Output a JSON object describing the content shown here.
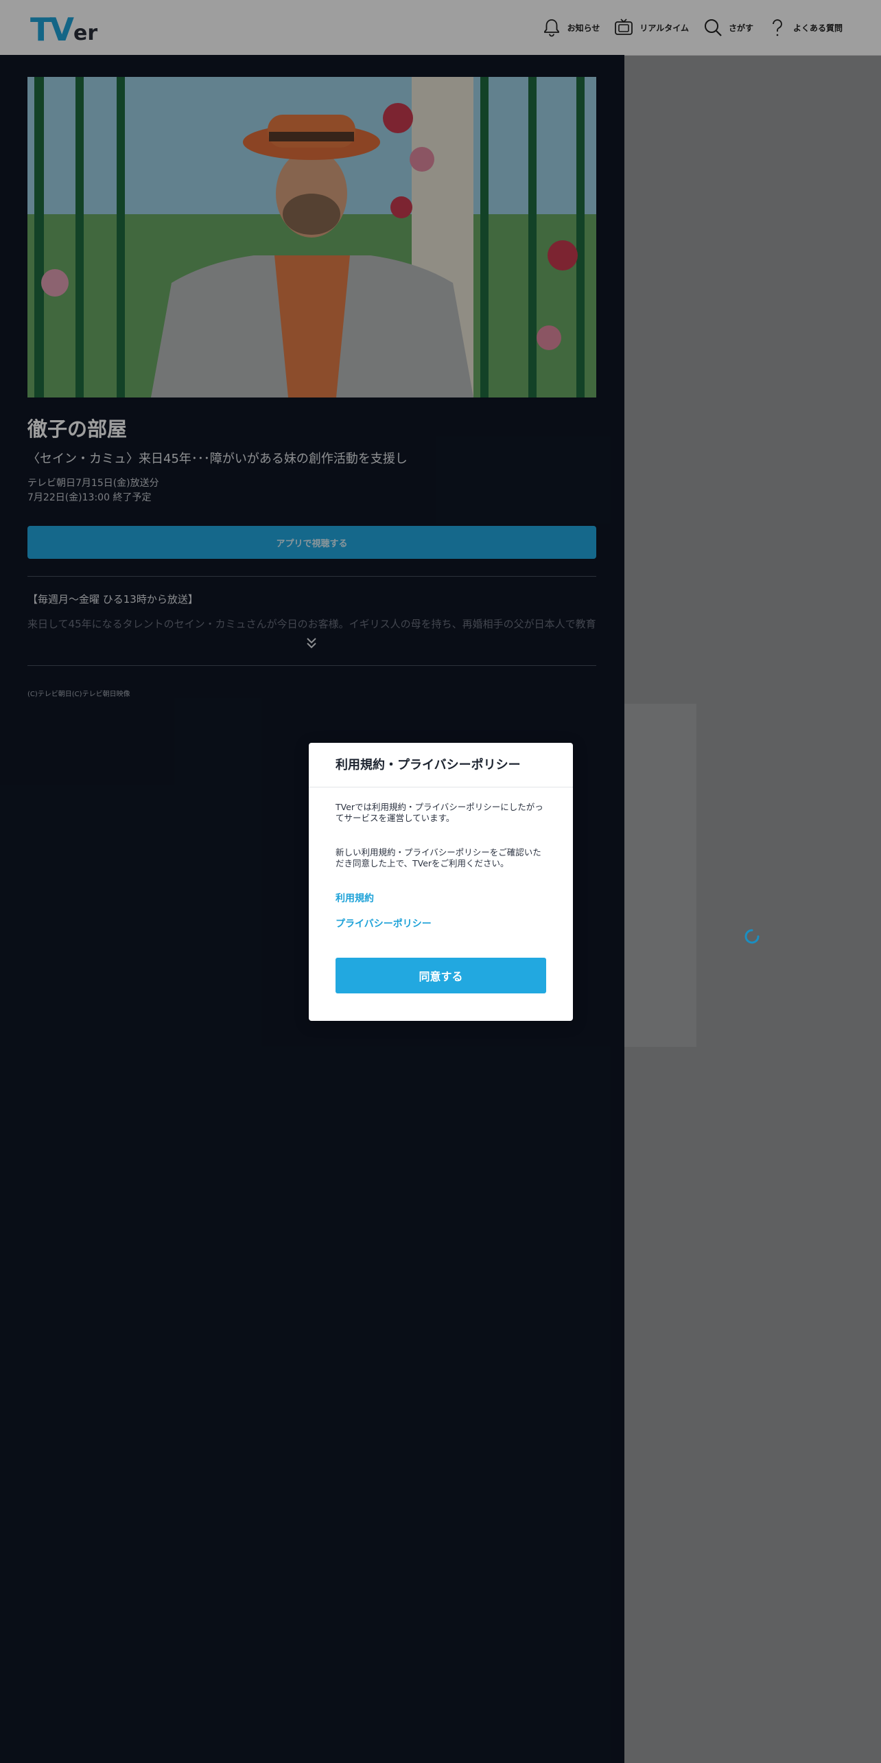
{
  "header": {
    "logo": "TVer",
    "nav": [
      {
        "label": "お知らせ",
        "icon": "bell-icon"
      },
      {
        "label": "リアルタイム",
        "icon": "tv-icon"
      },
      {
        "label": "さがす",
        "icon": "search-icon"
      },
      {
        "label": "よくある質問",
        "icon": "question-icon"
      }
    ]
  },
  "program": {
    "title": "徹子の部屋",
    "subtitle": "〈セイン・カミュ〉来日45年･･･障がいがある妹の創作活動を支援し",
    "broadcast": "テレビ朝日7月15日(金)放送分",
    "expiry": "7月22日(金)13:00 終了予定",
    "app_button": "アプリで視聴する",
    "schedule": "【毎週月～金曜 ひる13時から放送】",
    "description": "来日して45年になるタレントのセイン・カミュさんが今日のお客様。イギリス人の母を持ち、再婚相手の父が日本人で教育",
    "copyright": "(C)テレビ朝日(C)テレビ朝日映像"
  },
  "modal": {
    "title": "利用規約・プライバシーポリシー",
    "p1": "TVerでは利用規約・プライバシーポリシーにしたがってサービスを運営しています。",
    "p2": "新しい利用規約・プライバシーポリシーをご確認いただき同意した上で、TVerをご利用ください。",
    "link_terms": "利用規約",
    "link_privacy": "プライバシーポリシー",
    "agree_button": "同意する"
  },
  "colors": {
    "accent": "#22a8e0",
    "main_bg": "#0f1625",
    "link": "#1ea2d8"
  }
}
